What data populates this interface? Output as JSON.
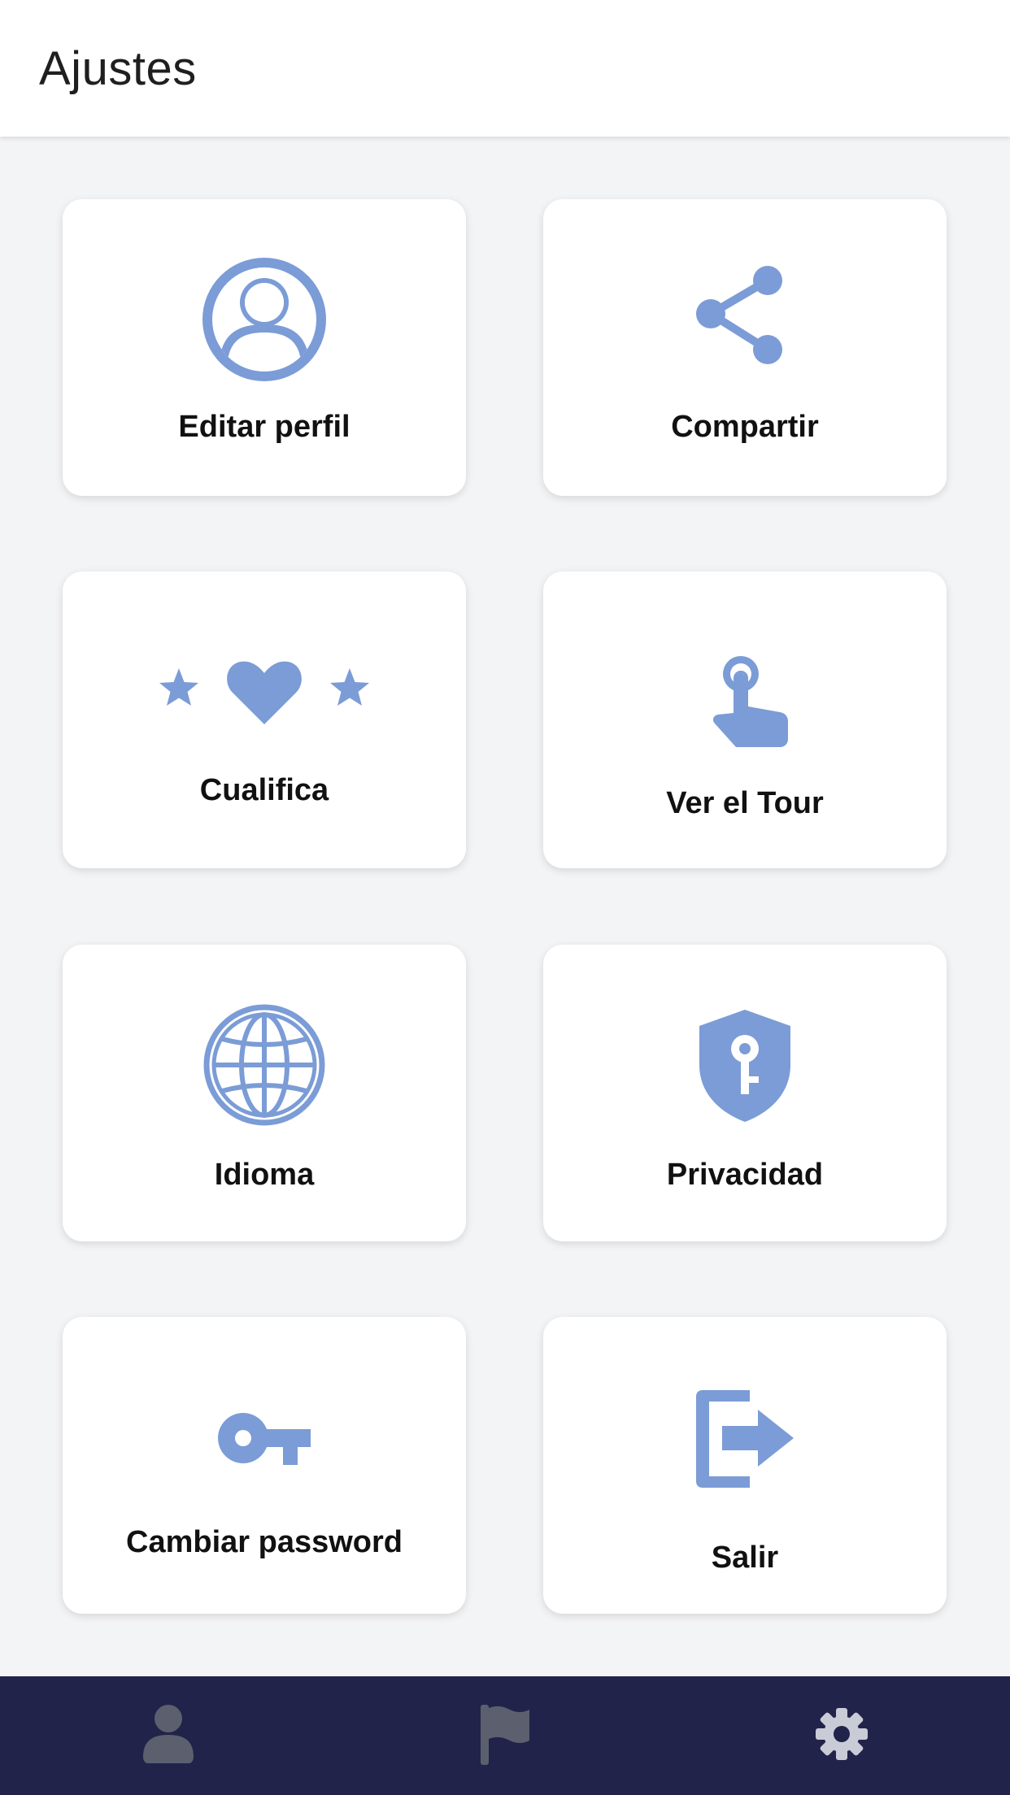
{
  "header": {
    "title": "Ajustes"
  },
  "colors": {
    "accent": "#7b9cd6",
    "nav_bg": "#22234a",
    "nav_icon_inactive": "#5c5f6e",
    "nav_icon_active": "#c9ccd6"
  },
  "settings": {
    "edit_profile": {
      "label": "Editar perfil",
      "icon": "user-circle-icon"
    },
    "share": {
      "label": "Compartir",
      "icon": "share-icon"
    },
    "rate": {
      "label": "Cualifica",
      "icon": "stars-heart-icon"
    },
    "tour": {
      "label": "Ver el Tour",
      "icon": "tap-hand-icon"
    },
    "language": {
      "label": "Idioma",
      "icon": "globe-icon"
    },
    "privacy": {
      "label": "Privacidad",
      "icon": "shield-key-icon"
    },
    "change_password": {
      "label": "Cambiar password",
      "icon": "key-icon"
    },
    "logout": {
      "label": "Salir",
      "icon": "logout-icon"
    }
  },
  "bottom_nav": {
    "items": [
      {
        "icon": "user-icon",
        "active": false
      },
      {
        "icon": "flag-icon",
        "active": false
      },
      {
        "icon": "gear-icon",
        "active": true
      }
    ]
  }
}
